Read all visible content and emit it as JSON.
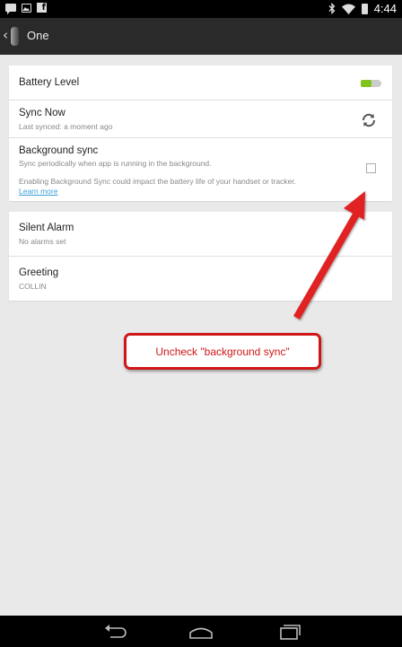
{
  "status_bar": {
    "time": "4:44",
    "left_icons": [
      "chat-icon",
      "image-icon",
      "facebook-icon"
    ],
    "right_icons": [
      "bluetooth-icon",
      "wifi-icon",
      "battery-icon"
    ],
    "facebook_glyph": "f"
  },
  "action_bar": {
    "back_glyph": "‹",
    "title": "One"
  },
  "settings": {
    "battery": {
      "title": "Battery Level",
      "level": 0.5,
      "level_color": "#80c41c"
    },
    "sync_now": {
      "title": "Sync Now",
      "subtitle": "Last synced: a moment ago"
    },
    "background_sync": {
      "title": "Background sync",
      "subtitle": "Sync periodically when app is running in the background.",
      "warning": "Enabling Background Sync could impact the battery life of your handset or tracker.",
      "link": "Learn more",
      "checked": false
    },
    "silent_alarm": {
      "title": "Silent Alarm",
      "subtitle": "No alarms set"
    },
    "greeting": {
      "title": "Greeting",
      "subtitle": "COLLIN"
    }
  },
  "annotation": {
    "text": "Uncheck \"background sync\"",
    "color": "#d01616"
  },
  "nav_bar": {
    "buttons": [
      "back-icon",
      "home-icon",
      "recents-icon"
    ]
  }
}
